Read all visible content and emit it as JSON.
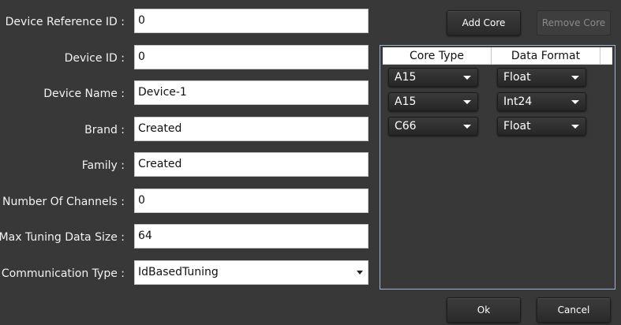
{
  "form": {
    "device_reference_id": {
      "label": "Device Reference ID :",
      "value": "0"
    },
    "device_id": {
      "label": "Device ID :",
      "value": "0"
    },
    "device_name": {
      "label": "Device Name :",
      "value": "Device-1"
    },
    "brand": {
      "label": "Brand :",
      "value": "Created"
    },
    "family": {
      "label": "Family :",
      "value": "Created"
    },
    "number_of_channels": {
      "label": "Number Of Channels :",
      "value": "0"
    },
    "max_tuning_data_size": {
      "label": "Max Tuning Data Size :",
      "value": "64"
    },
    "communication_type": {
      "label": "Communication Type :",
      "value": "IdBasedTuning",
      "icon": "chevron-down-icon"
    }
  },
  "cores": {
    "add_label": "Add Core",
    "remove_label": "Remove Core",
    "remove_enabled": false,
    "columns": [
      "Core Type",
      "Data Format"
    ],
    "rows": [
      {
        "core_type": "A15",
        "data_format": "Float"
      },
      {
        "core_type": "A15",
        "data_format": "Int24"
      },
      {
        "core_type": "C66",
        "data_format": "Float"
      }
    ]
  },
  "footer": {
    "ok_label": "Ok",
    "cancel_label": "Cancel"
  },
  "colors": {
    "background": "#383838",
    "grid_border": "#9fb4d8"
  }
}
